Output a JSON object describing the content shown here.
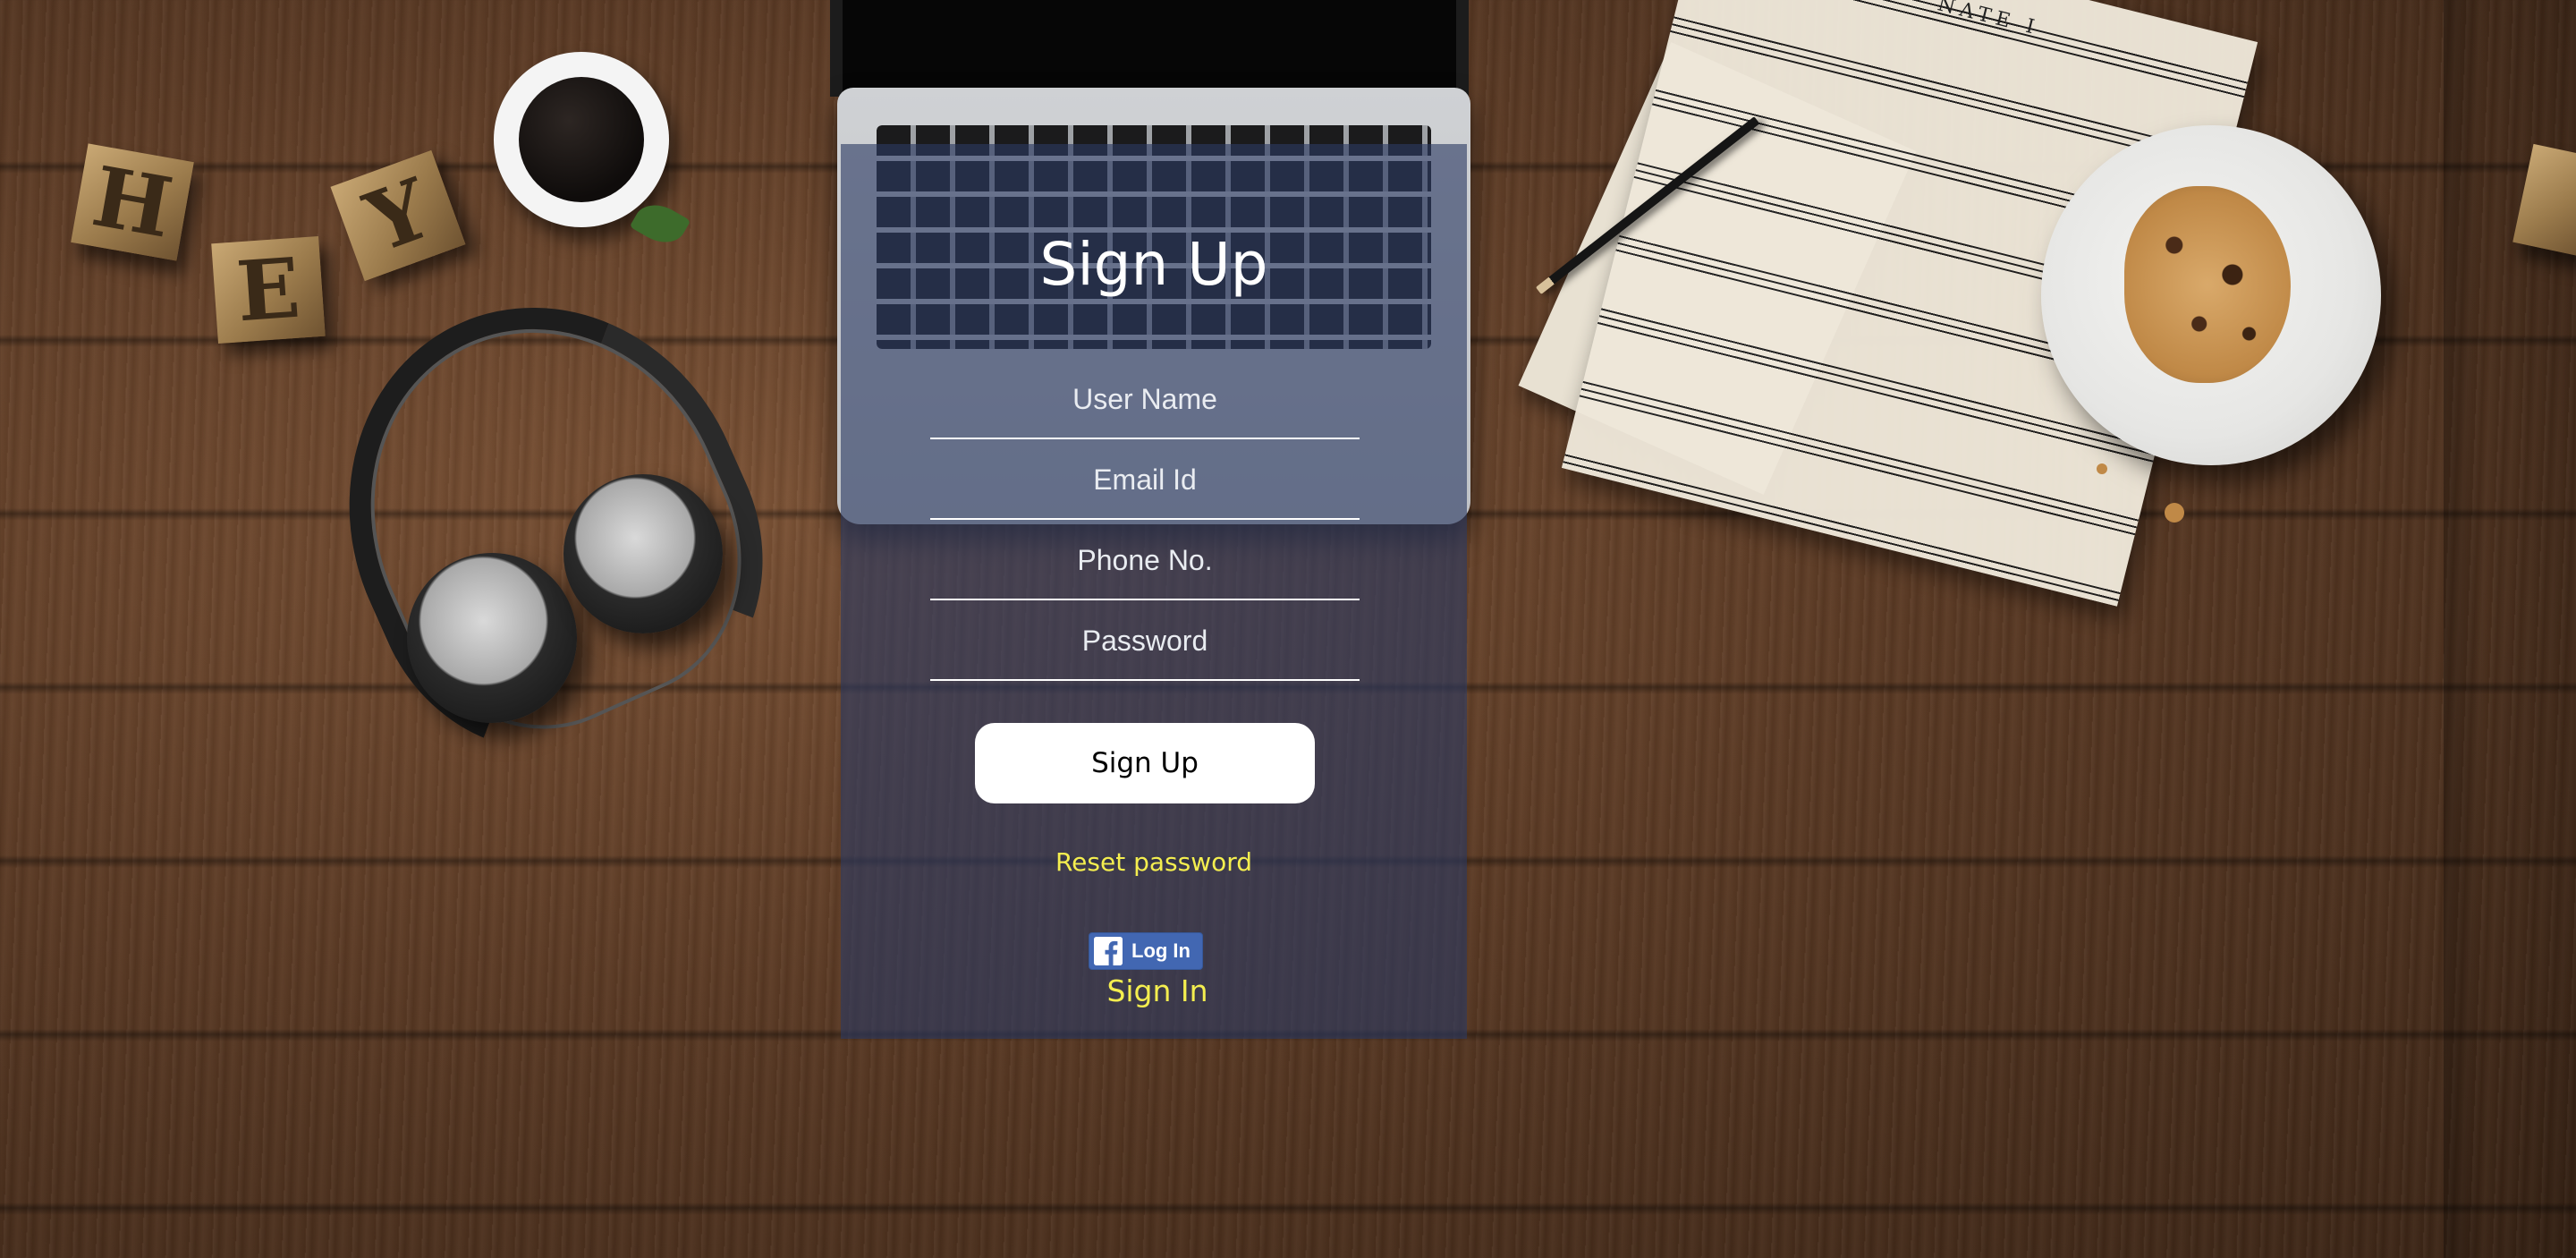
{
  "form": {
    "title": "Sign Up",
    "fields": [
      {
        "name": "username",
        "placeholder": "User Name",
        "value": ""
      },
      {
        "name": "email",
        "placeholder": "Email Id",
        "value": ""
      },
      {
        "name": "phone",
        "placeholder": "Phone No.",
        "value": ""
      },
      {
        "name": "password",
        "placeholder": "Password",
        "value": ""
      }
    ],
    "submit_label": "Sign Up",
    "reset_label": "Reset password",
    "facebook_label": "Log In",
    "signin_label": "Sign In"
  },
  "background": {
    "letter_blocks": [
      "H",
      "E",
      "Y"
    ],
    "sheet_music_title": "NATE I"
  },
  "colors": {
    "panel_overlay": "#2c3a62",
    "link_yellow": "#f4ee4f",
    "facebook_blue": "#4267b2",
    "button_white": "#ffffff"
  },
  "icons": {
    "facebook": "facebook-icon"
  }
}
